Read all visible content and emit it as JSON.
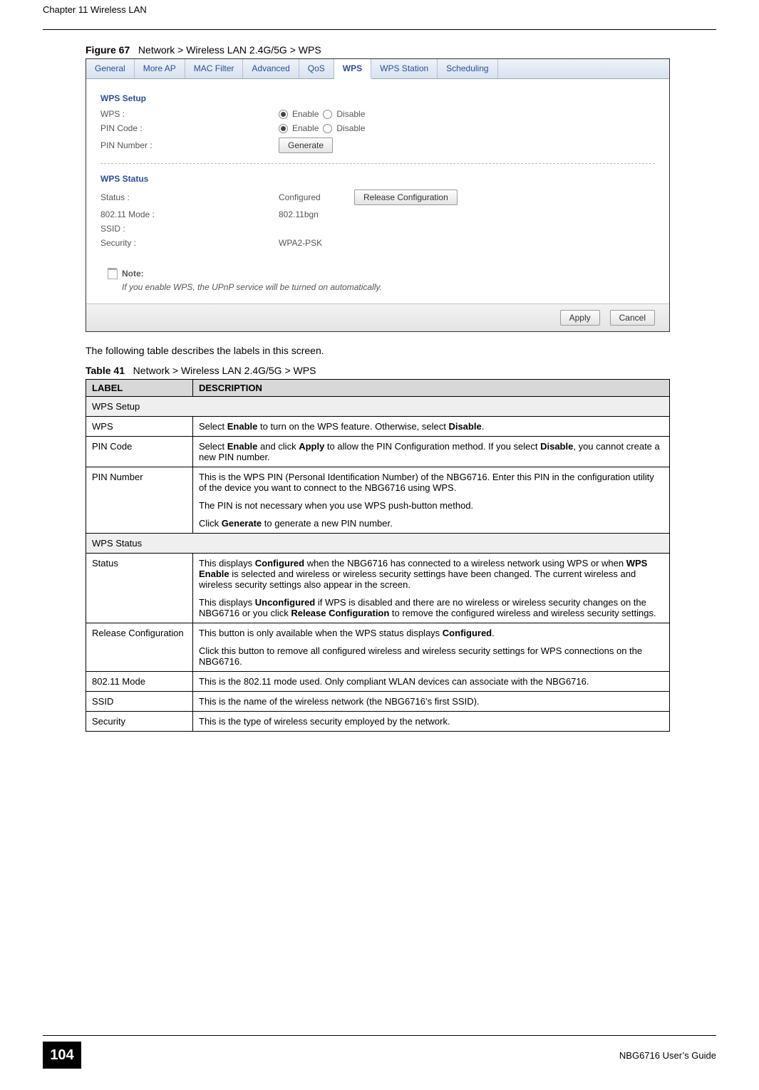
{
  "header": {
    "chapter": "Chapter 11 Wireless LAN"
  },
  "figure": {
    "label": "Figure 67",
    "title": "Network > Wireless LAN 2.4G/5G > WPS"
  },
  "tabs": [
    "General",
    "More AP",
    "MAC Filter",
    "Advanced",
    "QoS",
    "WPS",
    "WPS Station",
    "Scheduling"
  ],
  "wps_setup": {
    "section": "WPS Setup",
    "rows": {
      "wps_label": "WPS :",
      "pin_code_label": "PIN Code :",
      "pin_number_label": "PIN Number :",
      "enable": "Enable",
      "disable": "Disable",
      "generate": "Generate"
    }
  },
  "wps_status": {
    "section": "WPS Status",
    "rows": {
      "status_label": "Status :",
      "status_value": "Configured",
      "release_btn": "Release Configuration",
      "mode_label": "802.11 Mode :",
      "mode_value": "802.11bgn",
      "ssid_label": "SSID :",
      "ssid_value": "",
      "security_label": "Security :",
      "security_value": "WPA2-PSK"
    }
  },
  "note": {
    "title": "Note:",
    "text": "If you enable WPS, the UPnP service will be turned on automatically."
  },
  "buttons": {
    "apply": "Apply",
    "cancel": "Cancel"
  },
  "body_text": "The following table describes the labels in this screen.",
  "table": {
    "label": "Table 41",
    "title": "Network > Wireless LAN 2.4G/5G > WPS",
    "head_label": "LABEL",
    "head_desc": "DESCRIPTION",
    "rows": [
      {
        "type": "section",
        "label": "WPS Setup"
      },
      {
        "label": "WPS",
        "desc_html": "Select <b>Enable</b> to turn on the WPS feature. Otherwise, select <b>Disable</b>."
      },
      {
        "label": "PIN Code",
        "desc_html": "Select <b>Enable</b> and click <b>Apply</b> to allow the PIN Configuration method. If you select <b>Disable</b>, you cannot create a new PIN number."
      },
      {
        "label": "PIN Number",
        "desc_html": "<p>This is the WPS PIN (Personal Identification Number) of the NBG6716. Enter this PIN in the configuration utility of the device you want to connect to the NBG6716 using WPS.</p><p>The PIN is not necessary when you use WPS push-button method.</p><p>Click <b>Generate</b> to generate a new PIN number.</p>"
      },
      {
        "type": "section",
        "label": "WPS Status"
      },
      {
        "label": "Status",
        "desc_html": "<p>This displays <b>Configured</b> when the NBG6716 has connected to a wireless network using WPS or when <b>WPS Enable</b> is selected and wireless or wireless security settings have been changed. The current wireless and wireless security settings also appear in the screen.</p><p>This displays <b>Unconfigured</b> if WPS is disabled and there are no wireless or wireless security changes on the NBG6716 or you click <b>Release Configuration</b> to remove the configured wireless and wireless security settings.</p>"
      },
      {
        "label": "Release Configuration",
        "desc_html": "<p>This button is only available when the WPS status displays <b>Configured</b>.</p><p>Click this button to remove all configured wireless and wireless security settings for WPS connections on the NBG6716.</p>"
      },
      {
        "label": "802.11 Mode",
        "desc_html": "This is the 802.11 mode used. Only compliant WLAN devices can associate with the NBG6716."
      },
      {
        "label": "SSID",
        "desc_html": "This is the name of the wireless network (the NBG6716’s first SSID)."
      },
      {
        "label": "Security",
        "desc_html": "This is the type of wireless security employed by the network."
      }
    ]
  },
  "footer": {
    "page": "104",
    "guide": "NBG6716 User’s Guide"
  },
  "chart_data": null
}
